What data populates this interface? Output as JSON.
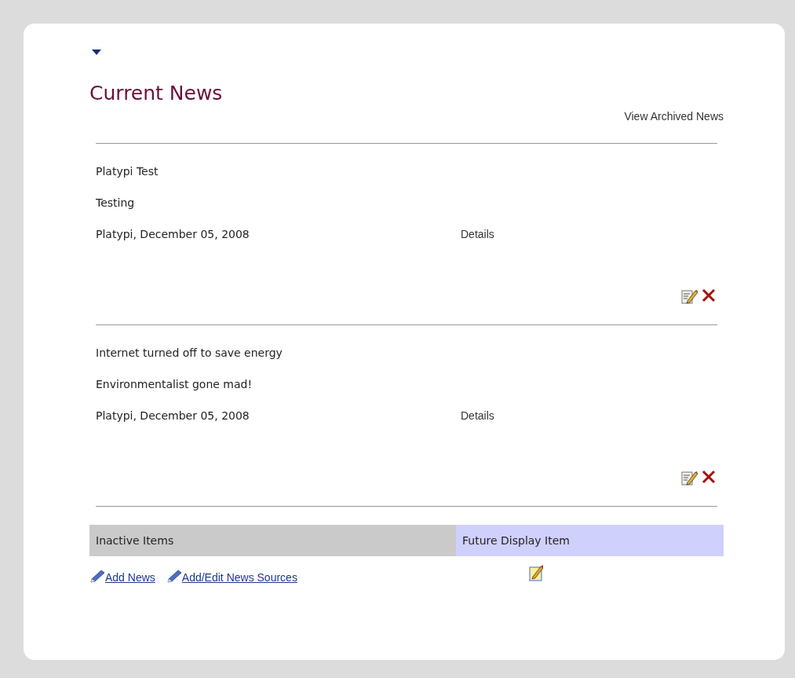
{
  "title": "Current News",
  "archive_link": "View Archived News",
  "news": [
    {
      "title": "Platypi Test",
      "body": "Testing",
      "byline": "Platypi, December 05, 2008",
      "details": "Details"
    },
    {
      "title": "Internet turned off to save energy",
      "body": "Environmentalist gone mad!",
      "byline": "Platypi, December 05, 2008",
      "details": "Details"
    }
  ],
  "footer": {
    "inactive_label": "Inactive Items",
    "future_label": "Future Display Item",
    "links": [
      "Add News",
      "Add/Edit News Sources"
    ]
  }
}
